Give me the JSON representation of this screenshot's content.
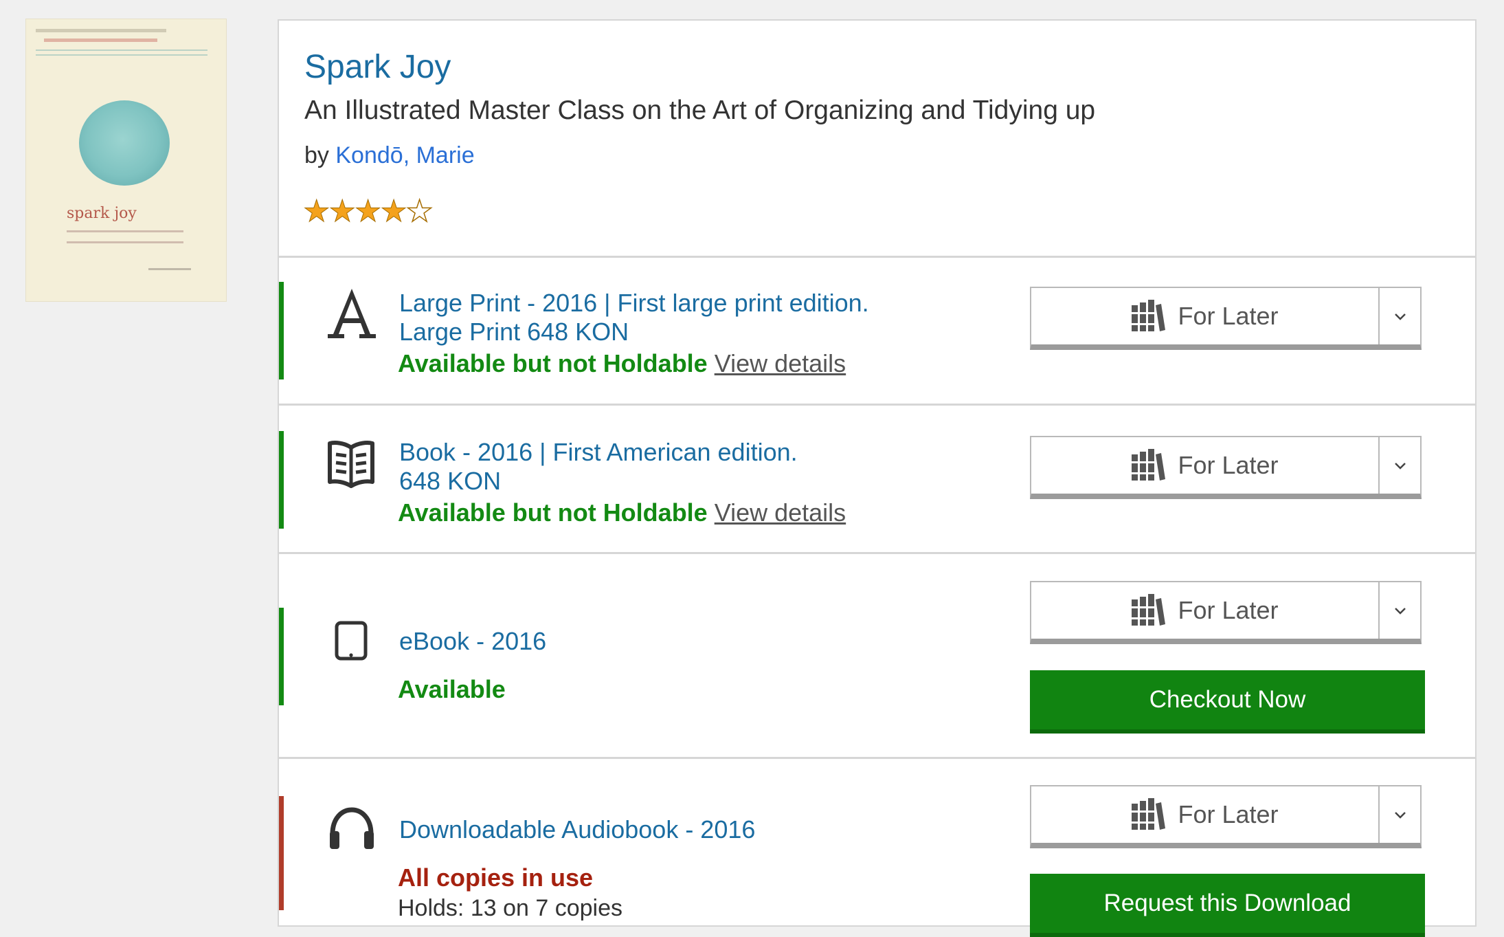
{
  "book": {
    "title": "Spark Joy",
    "subtitle": "An Illustrated Master Class on the Art of Organizing and Tidying up",
    "by_prefix": "by",
    "author": "Kondō, Marie",
    "rating_stars": 4,
    "rating_max": 5
  },
  "cover": {
    "title": "spark joy",
    "circle_color": "#7fc3c1",
    "title_color": "#b4584a",
    "background_color": "#f4efd9"
  },
  "colors": {
    "link": "#1a6ca1",
    "author_link": "#2a6fd6",
    "available": "#138a13",
    "unavailable": "#a5210f",
    "button_green": "#118411",
    "star": "#f4a21c"
  },
  "formats": [
    {
      "icon": "large-print-icon",
      "line1": "Large Print - 2016 | First large print edition.",
      "line2": "Large Print 648 KON",
      "status": "Available but not Holdable",
      "details_link": "View details",
      "for_later": "For Later"
    },
    {
      "icon": "book-icon",
      "line1": "Book - 2016 | First American edition.",
      "line2": "648 KON",
      "status": "Available but not Holdable",
      "details_link": "View details",
      "for_later": "For Later"
    },
    {
      "icon": "tablet-icon",
      "line1": "eBook - 2016",
      "status": "Available",
      "for_later": "For Later",
      "action": "Checkout Now"
    },
    {
      "icon": "headphones-icon",
      "line1": "Downloadable Audiobook - 2016",
      "status": "All copies in use",
      "holds": "Holds: 13 on 7 copies",
      "for_later": "For Later",
      "action": "Request this Download"
    }
  ]
}
